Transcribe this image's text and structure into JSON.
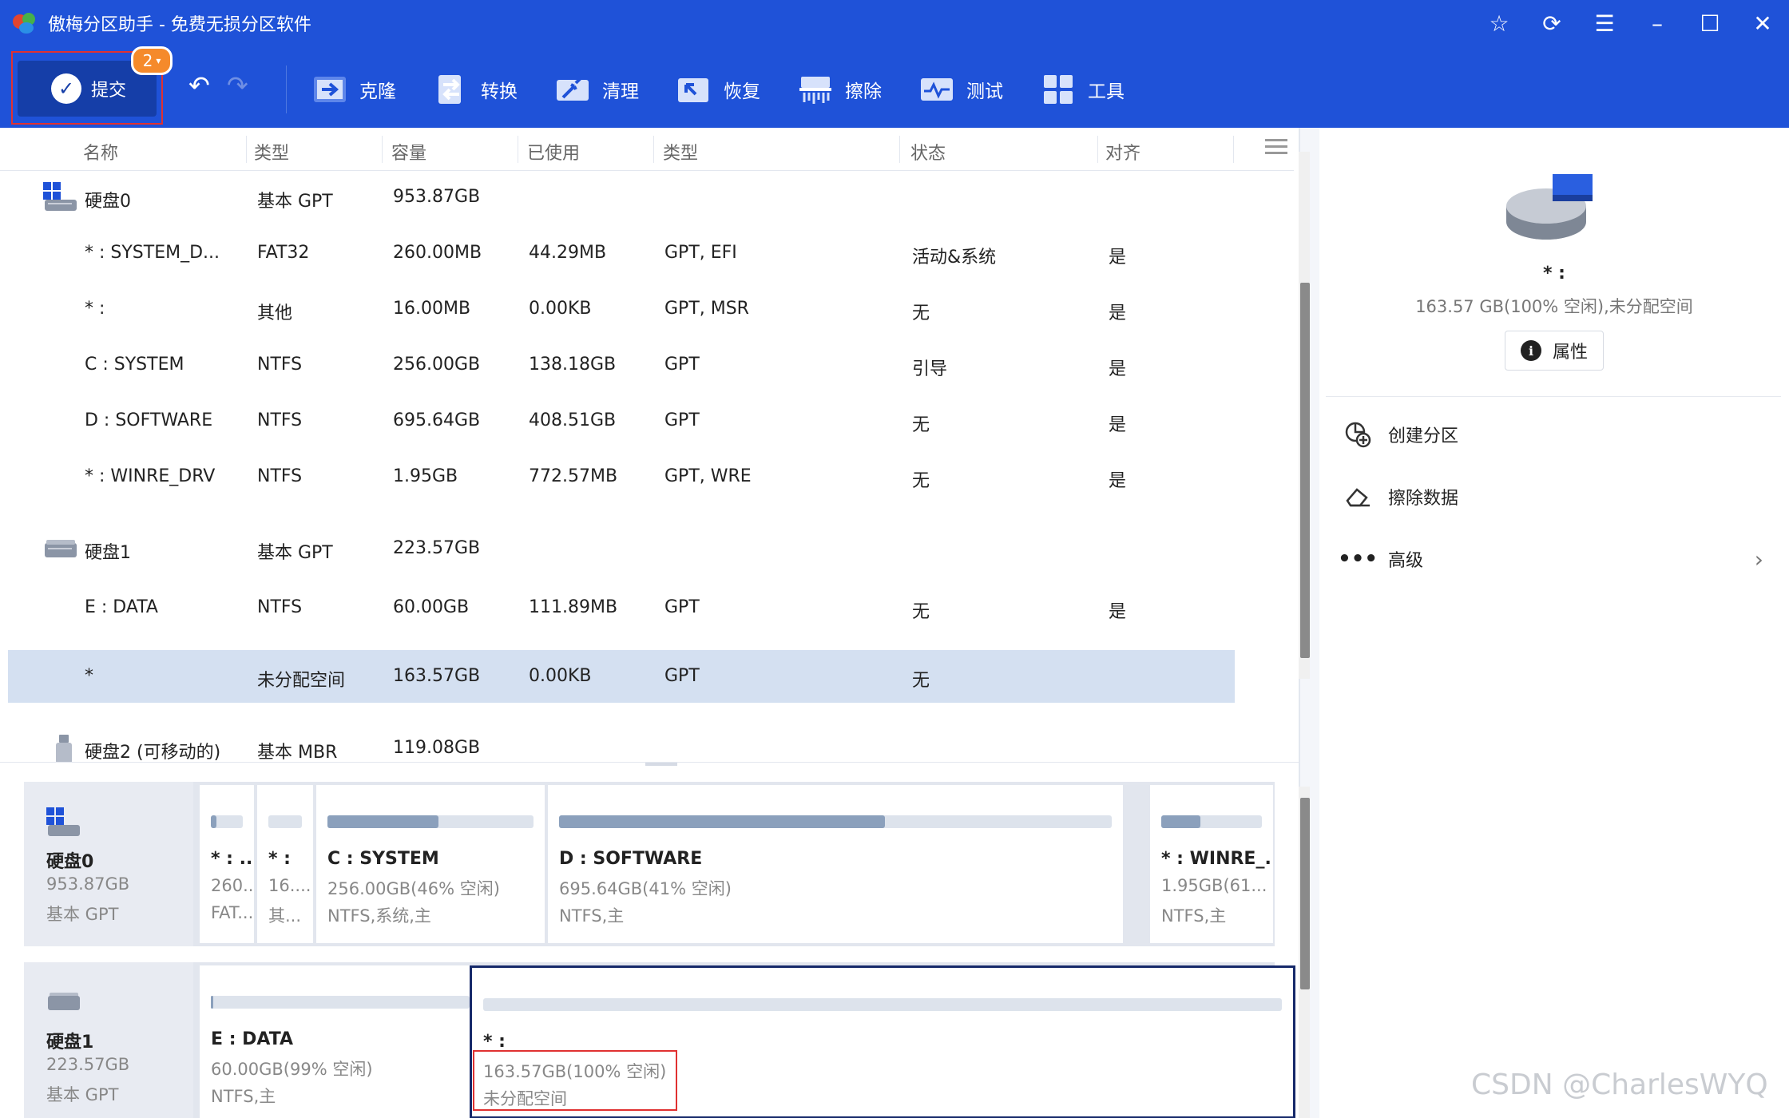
{
  "app": {
    "title": "傲梅分区助手 - 免费无损分区软件",
    "title_controls": [
      "star-icon",
      "refresh-icon",
      "menu-icon",
      "minimize-icon",
      "maximize-icon",
      "close-icon"
    ]
  },
  "toolbar": {
    "submit_label": "提交",
    "submit_badge": "2",
    "tools": [
      {
        "label": "克隆",
        "icon": "clone-icon"
      },
      {
        "label": "转换",
        "icon": "convert-icon"
      },
      {
        "label": "清理",
        "icon": "clean-icon"
      },
      {
        "label": "恢复",
        "icon": "restore-icon"
      },
      {
        "label": "擦除",
        "icon": "wipe-icon"
      },
      {
        "label": "测试",
        "icon": "test-icon"
      },
      {
        "label": "工具",
        "icon": "tools-icon"
      }
    ]
  },
  "table": {
    "headers": [
      "名称",
      "类型",
      "容量",
      "已使用",
      "类型",
      "状态",
      "对齐"
    ],
    "rows": [
      {
        "kind": "disk",
        "name": "硬盘0",
        "type": "基本 GPT",
        "capacity": "953.87GB",
        "used": "",
        "fs": "",
        "status": "",
        "align": ""
      },
      {
        "kind": "part",
        "name": "* : SYSTEM_D...",
        "type": "FAT32",
        "capacity": "260.00MB",
        "used": "44.29MB",
        "fs": "GPT, EFI",
        "status": "活动&系统",
        "align": "是"
      },
      {
        "kind": "part",
        "name": "* :",
        "type": "其他",
        "capacity": "16.00MB",
        "used": "0.00KB",
        "fs": "GPT, MSR",
        "status": "无",
        "align": "是"
      },
      {
        "kind": "part",
        "name": "C : SYSTEM",
        "type": "NTFS",
        "capacity": "256.00GB",
        "used": "138.18GB",
        "fs": "GPT",
        "status": "引导",
        "align": "是"
      },
      {
        "kind": "part",
        "name": "D : SOFTWARE",
        "type": "NTFS",
        "capacity": "695.64GB",
        "used": "408.51GB",
        "fs": "GPT",
        "status": "无",
        "align": "是"
      },
      {
        "kind": "part",
        "name": "* : WINRE_DRV",
        "type": "NTFS",
        "capacity": "1.95GB",
        "used": "772.57MB",
        "fs": "GPT, WRE",
        "status": "无",
        "align": "是"
      },
      {
        "kind": "disk",
        "name": "硬盘1",
        "type": "基本 GPT",
        "capacity": "223.57GB",
        "used": "",
        "fs": "",
        "status": "",
        "align": ""
      },
      {
        "kind": "part",
        "name": "E : DATA",
        "type": "NTFS",
        "capacity": "60.00GB",
        "used": "111.89MB",
        "fs": "GPT",
        "status": "无",
        "align": "是"
      },
      {
        "kind": "part",
        "name": "*",
        "type": "未分配空间",
        "capacity": "163.57GB",
        "used": "0.00KB",
        "fs": "GPT",
        "status": "无",
        "align": "",
        "selected": true
      },
      {
        "kind": "usb",
        "name": "硬盘2 (可移动的)",
        "type": "基本 MBR",
        "capacity": "119.08GB",
        "used": "",
        "fs": "",
        "status": "",
        "align": ""
      }
    ]
  },
  "diskmap": [
    {
      "name": "硬盘0",
      "size": "953.87GB",
      "type": "基本 GPT",
      "parts": [
        {
          "name": "* : ...",
          "size": "260...",
          "type": "FAT...",
          "used_fraction": 0.17
        },
        {
          "name": "* :",
          "size": "16....",
          "type": "其...",
          "used_fraction": 0.0
        },
        {
          "name": "C : SYSTEM",
          "size": "256.00GB(46% 空闲)",
          "type": "NTFS,系统,主",
          "used_fraction": 0.54
        },
        {
          "name": "D : SOFTWARE",
          "size": "695.64GB(41% 空闲)",
          "type": "NTFS,主",
          "used_fraction": 0.59
        },
        {
          "name": "* : WINRE_...",
          "size": "1.95GB(61...",
          "type": "NTFS,主",
          "used_fraction": 0.39
        }
      ]
    },
    {
      "name": "硬盘1",
      "size": "223.57GB",
      "type": "基本 GPT",
      "parts": [
        {
          "name": "E : DATA",
          "size": "60.00GB(99% 空闲)",
          "type": "NTFS,主",
          "used_fraction": 0.01
        },
        {
          "name": "* :",
          "size": "163.57GB(100% 空闲)",
          "type": "未分配空间",
          "used_fraction": 0.0,
          "selected": true
        }
      ]
    }
  ],
  "side": {
    "name": "* :",
    "desc": "163.57 GB(100% 空闲),未分配空间",
    "props_label": "属性",
    "actions": [
      {
        "label": "创建分区",
        "icon": "create-partition-icon"
      },
      {
        "label": "擦除数据",
        "icon": "eraser-icon"
      },
      {
        "label": "高级",
        "icon": "more-icon"
      }
    ]
  },
  "watermark": "CSDN @CharlesWYQ",
  "colors": {
    "brand": "#1f52d8",
    "submit": "#153ea8",
    "badge": "#f58a2b",
    "selected_row": "#d4e0f1",
    "highlight": "#e03131"
  }
}
